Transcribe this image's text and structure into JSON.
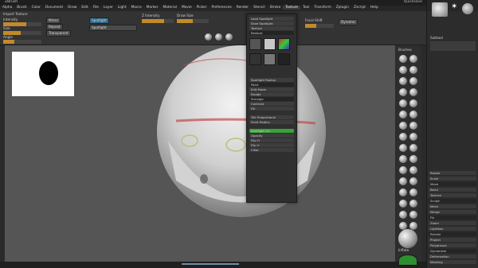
{
  "titlebar": {
    "title": "ZBrush",
    "right_info": "Quicksave",
    "menu_label": "Menu"
  },
  "menubar": {
    "items": [
      "Alpha",
      "Brush",
      "Color",
      "Document",
      "Draw",
      "Edit",
      "File",
      "Layer",
      "Light",
      "Macro",
      "Marker",
      "Material",
      "Movie",
      "Picker",
      "Preferences",
      "Render",
      "Stencil",
      "Stroke",
      "Texture",
      "Tool",
      "Transform",
      "Zplugin",
      "Zscript",
      "Help"
    ],
    "active_index": 18
  },
  "topshelf": {
    "import_label": "Import Texture",
    "sliders": [
      {
        "label": "Intensity",
        "fill": 0.6
      },
      {
        "label": "Size",
        "fill": 0.45
      },
      {
        "label": "Angle",
        "fill": 0.3
      }
    ],
    "options": [
      "Mirror",
      "Repeat",
      "Spotlight",
      "Transparent"
    ],
    "spotlight_btn": "Spotlight",
    "z_intensity_label": "Z Intensity",
    "draw_size_label": "Draw Size",
    "focal_label": "Focal Shift",
    "dynamic_label": "Dynamic"
  },
  "popup": {
    "rows": [
      "Load Spotlight",
      "Save Spotlight",
      "Texture",
      "Restore",
      "Spotlight Radius",
      "Paint",
      "Edit Mode",
      "Nudge",
      "Smudge",
      "Contrast",
      "Fill",
      "Tile Proportional",
      "Front Radius",
      "Opacity",
      "Flip H",
      "Flip V",
      "Spotlight On",
      "Clear"
    ],
    "green_label": "Spotlight On"
  },
  "right": {
    "tool_label": "Subtool",
    "rows": [
      "Rotate",
      "Scale",
      "Move",
      "Bend",
      "Texture",
      "Sculpt",
      "Mesh",
      "Merge",
      "Fix",
      "Zoom",
      "Lightbox",
      "Render",
      "Project",
      "Polygroups",
      "Dynamesh",
      "Deformation",
      "Masking"
    ],
    "bottom_label": "Inflate"
  },
  "brushes": {
    "label": "Brushes"
  },
  "colors": {
    "accent_orange": "#c28a2a",
    "accent_blue": "#2d6a8c",
    "green": "#3aa13a",
    "canvas_bg": "#555555"
  }
}
